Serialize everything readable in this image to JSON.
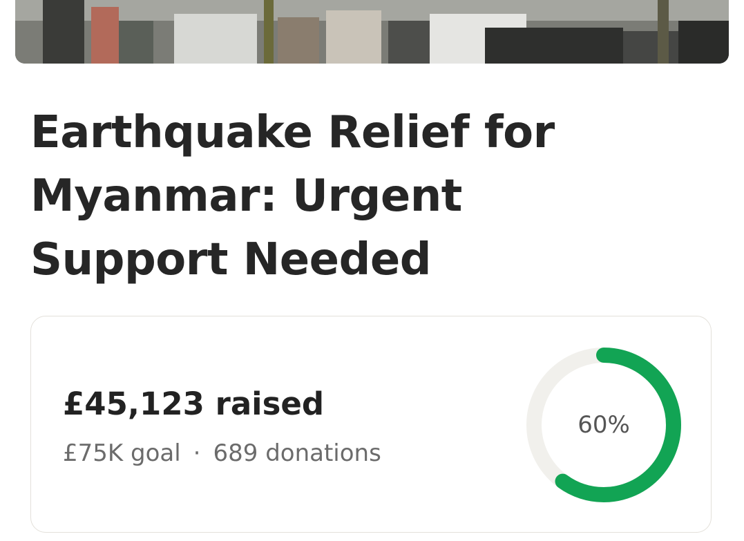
{
  "campaign": {
    "title_line1": "Earthquake Relief for",
    "title_line2": "Myanmar: Urgent",
    "title_line3": "Support Needed"
  },
  "stats": {
    "raised_text": "£45,123 raised",
    "goal_text": "£75K goal",
    "separator": "·",
    "donations_text": "689 donations",
    "progress_percent_text": "60%",
    "progress_fraction": 0.6
  },
  "colors": {
    "progress": "#12a454",
    "track": "#f1f0ec"
  }
}
